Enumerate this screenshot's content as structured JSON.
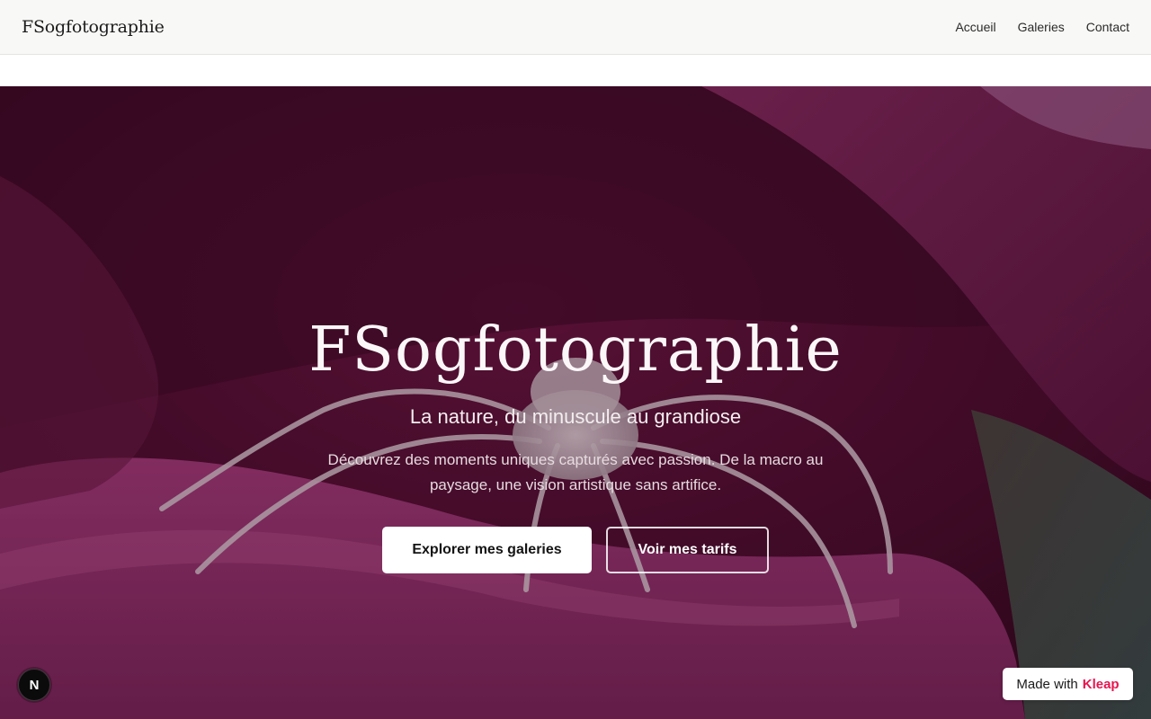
{
  "header": {
    "brand": "FSogfotographie",
    "nav": [
      {
        "label": "Accueil"
      },
      {
        "label": "Galeries"
      },
      {
        "label": "Contact"
      }
    ]
  },
  "hero": {
    "title": "FSogfotographie",
    "subtitle": "La nature, du minuscule au grandiose",
    "description": "Découvrez des moments uniques capturés avec passion. De la macro au paysage, une vision artistique sans artifice.",
    "primary_button": "Explorer mes galeries",
    "secondary_button": "Voir mes tarifs",
    "background_image": "macro photo of a pale crab spider on a magenta flower petal"
  },
  "badges": {
    "next_icon_letter": "N",
    "kleap_prefix": "Made with",
    "kleap_name": "Kleap"
  },
  "colors": {
    "petal": "#8e2a63",
    "petal_dark": "#3c0a24",
    "kleap_accent": "#e8144f",
    "header_bg": "#f8f8f6"
  }
}
